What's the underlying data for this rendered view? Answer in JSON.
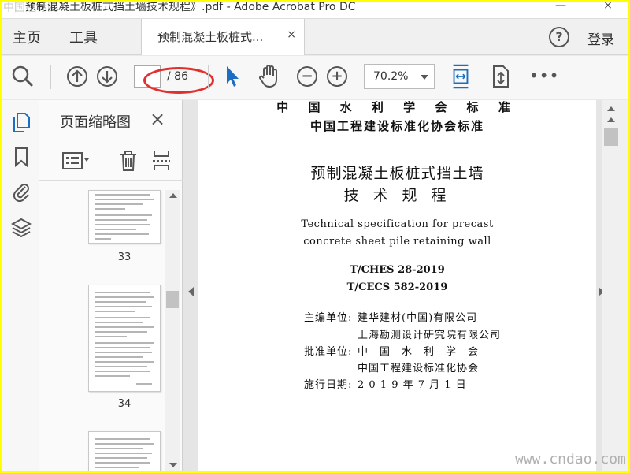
{
  "window": {
    "title": "预制混凝土板桩式挡土墙技术规程》.pdf - Adobe Acrobat Pro DC",
    "watermark": "中国建标网",
    "minimize": "—",
    "close": "×"
  },
  "nav": {
    "home": "主页",
    "tools": "工具",
    "doc_tab": "预制混凝土板桩式...",
    "tab_close": "×",
    "help": "?",
    "login": "登录"
  },
  "toolbar": {
    "page_current": "",
    "page_total": "/ 86",
    "zoom": "70.2%",
    "more": "•••"
  },
  "thumbnails": {
    "title": "页面缩略图",
    "close": "×",
    "pages": [
      {
        "number": "33"
      },
      {
        "number": "34"
      }
    ]
  },
  "document": {
    "header1": "中 国 水 利 学 会 标 准",
    "header2": "中国工程建设标准化协会标准",
    "title1": "预制混凝土板桩式挡土墙",
    "title2": "技 术 规 程",
    "en1": "Technical specification for precast",
    "en2": "concrete sheet pile retaining wall",
    "code1": "T/CHES 28-2019",
    "code2": "T/CECS 582-2019",
    "rows": [
      {
        "label": "主编单位:",
        "value": "建华建材(中国)有限公司"
      },
      {
        "label": "",
        "value": "上海勘测设计研究院有限公司"
      },
      {
        "label": "批准单位:",
        "value": "中　国　水　利　学　会"
      },
      {
        "label": "",
        "value": "中国工程建设标准化协会"
      },
      {
        "label": "施行日期:",
        "value": "2 0 1 9 年 7 月 1 日"
      }
    ]
  },
  "footer_watermark": "www.cndao.com",
  "colors": {
    "accent": "#1b6ec2",
    "annotation": "#e23030",
    "border_highlight": "#ffff00"
  }
}
